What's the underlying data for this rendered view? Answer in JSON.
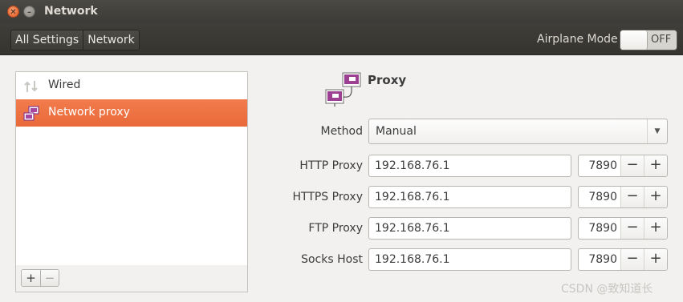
{
  "window": {
    "title": "Network"
  },
  "toolbar": {
    "breadcrumbs": [
      "All Settings",
      "Network"
    ],
    "airplane_mode_label": "Airplane Mode",
    "airplane_mode_state": "OFF"
  },
  "sidebar": {
    "items": [
      {
        "label": "Wired",
        "icon": "network-wired-icon",
        "selected": false
      },
      {
        "label": "Network proxy",
        "icon": "network-proxy-icon",
        "selected": true
      }
    ],
    "add_label": "+",
    "remove_label": "−"
  },
  "proxy": {
    "title": "Proxy",
    "method_label": "Method",
    "method_value": "Manual",
    "rows": [
      {
        "label": "HTTP Proxy",
        "host": "192.168.76.1",
        "port": "7890"
      },
      {
        "label": "HTTPS Proxy",
        "host": "192.168.76.1",
        "port": "7890"
      },
      {
        "label": "FTP Proxy",
        "host": "192.168.76.1",
        "port": "7890"
      },
      {
        "label": "Socks Host",
        "host": "192.168.76.1",
        "port": "7890"
      }
    ],
    "minus": "−",
    "plus": "+"
  },
  "colors": {
    "accent": "#f07746",
    "titlebar": "#3c3b37",
    "proxy_icon": "#8b3a8b"
  },
  "watermark": "CSDN @致知道长"
}
